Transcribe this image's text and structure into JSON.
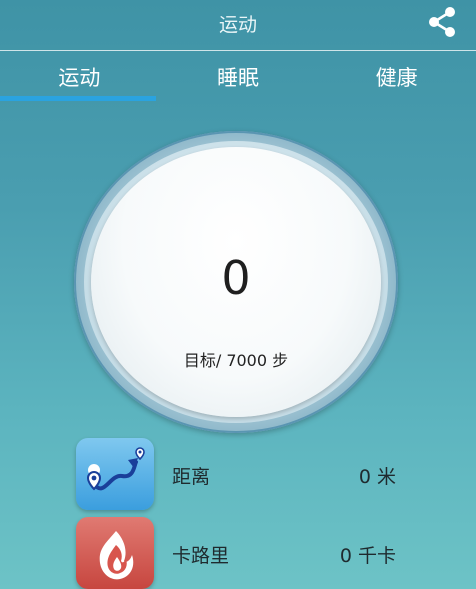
{
  "header": {
    "title": "运动",
    "share_icon": "share-icon"
  },
  "tabs": [
    {
      "label": "运动",
      "active": true
    },
    {
      "label": "睡眠",
      "active": false
    },
    {
      "label": "健康",
      "active": false
    }
  ],
  "dial": {
    "steps": "0",
    "goal_text": "目标/ 7000 步"
  },
  "stats": {
    "distance": {
      "icon": "route-map-icon",
      "label": "距离",
      "value": "0 米"
    },
    "calories": {
      "icon": "flame-icon",
      "label": "卡路里",
      "value": "0 千卡"
    }
  },
  "colors": {
    "tab_underline": "#2aa3e0",
    "distance_icon_bg": "#3b9ede",
    "calories_icon_bg": "#c7463f"
  }
}
